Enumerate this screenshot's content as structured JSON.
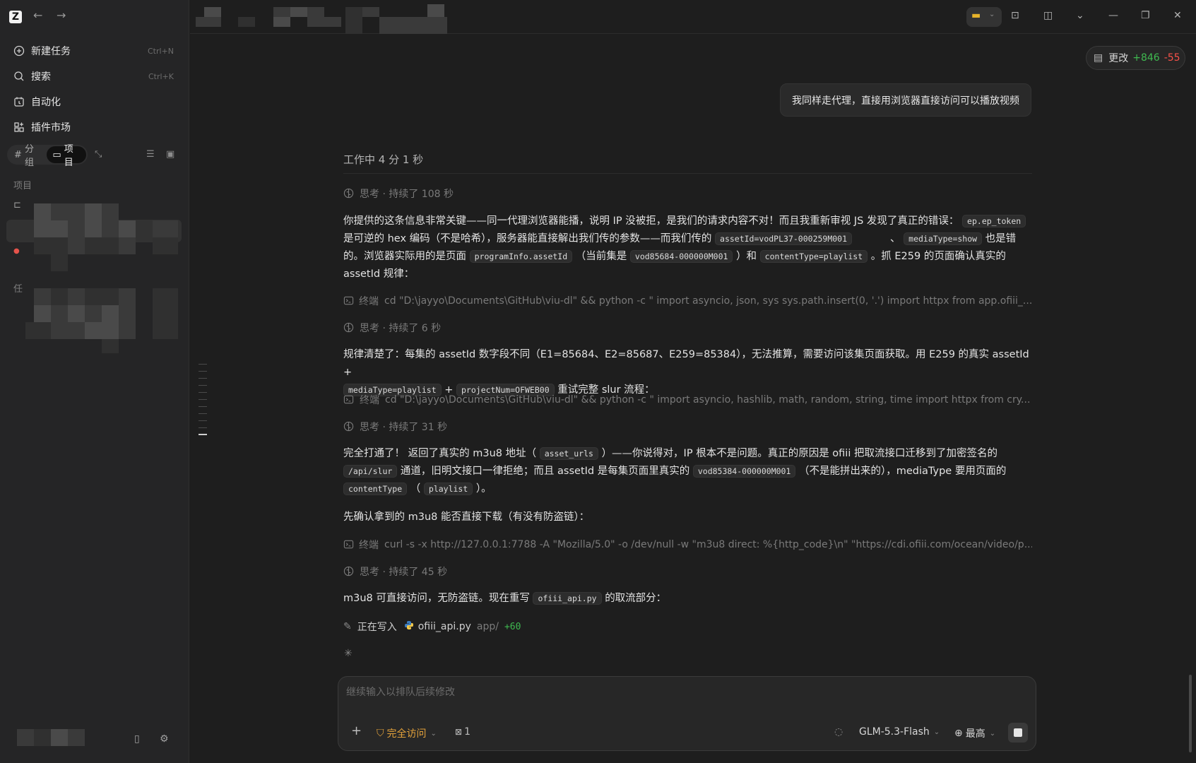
{
  "app": {
    "logo": "Z"
  },
  "sidebar": {
    "menu": [
      {
        "label": "新建任务",
        "shortcut": "Ctrl+N",
        "icon": "new-task-icon"
      },
      {
        "label": "搜索",
        "shortcut": "Ctrl+K",
        "icon": "search-icon"
      },
      {
        "label": "自动化",
        "shortcut": "",
        "icon": "automation-icon"
      },
      {
        "label": "插件市场",
        "shortcut": "",
        "icon": "plugin-icon"
      }
    ],
    "segment": {
      "group": "分组",
      "project": "项目"
    },
    "section_projects": "项目",
    "section_tasks": "任"
  },
  "header": {
    "changes_label": "更改",
    "additions": "+846",
    "deletions": "-55"
  },
  "conversation": {
    "user_message": "我同样走代理，直接用浏览器直接访问可以播放视频",
    "working_status": "工作中 4 分 1 秒",
    "think1": "思考 · 持续了 108 秒",
    "p1": [
      "你提供的这条信息非常关键——同一代理浏览器能播，说明 IP 没被拒，是我们的请求内容不对！而且我重新审视 JS 发现了真正的错误：",
      "ep.ep_token",
      "是可逆的 hex 编码（不是哈希），服务器能直接解出我们传的参数——而我们传的",
      "assetId=vodPL37-000259M001",
      "、",
      "mediaType=show",
      "也是错的。浏览器实际用的是页面",
      "programInfo.assetId",
      "（当前集是",
      "vod85684-000000M001",
      "）和",
      "contentType=playlist",
      "。抓 E259 的页面确认真实的 assetId 规律："
    ],
    "cmd1_label": "终端",
    "cmd1": "cd \"D:\\jayyo\\Documents\\GitHub\\viu-dl\" && python -c \" import asyncio, json, sys sys.path.insert(0, '.') import httpx from app.ofiii_...",
    "think2": "思考 · 持续了 6 秒",
    "p2": [
      "规律清楚了：每集的 assetId 数字段不同（E1=85684、E2=85687、E259=85384），无法推算，需要访问该集页面获取。用 E259 的真实 assetId +",
      "mediaType=playlist",
      "+",
      "projectNum=OFWEB00",
      "重试完整 slur 流程："
    ],
    "cmd2_label": "终端",
    "cmd2": "cd \"D:\\jayyo\\Documents\\GitHub\\viu-dl\" && python -c \" import asyncio, hashlib, math, random, string, time import httpx from cry...",
    "think3": "思考 · 持续了 31 秒",
    "p3": [
      "完全打通了！ 返回了真实的 m3u8 地址（",
      "asset_urls",
      "）——你说得对，IP 根本不是问题。真正的原因是 ofiii 把取流接口迁移到了加密签名的",
      "/api/slur",
      "通道，旧明文接口一律拒绝；而且 assetId 是每集页面里真实的",
      "vod85384-000000M001",
      "（不是能拼出来的），mediaType 要用页面的",
      "contentType",
      "（",
      "playlist",
      "）。"
    ],
    "p4": "先确认拿到的 m3u8 能否直接下载（有没有防盗链）：",
    "cmd3_label": "终端",
    "cmd3": "curl -s -x http://127.0.0.1:7788 -A \"Mozilla/5.0\" -o /dev/null -w \"m3u8 direct: %{http_code}\\n\" \"https://cdi.ofiii.com/ocean/video/p...",
    "think4": "思考 · 持续了 45 秒",
    "p5": [
      "m3u8 可直接访问，无防盗链。现在重写",
      "ofiii_api.py",
      "的取流部分："
    ],
    "writing_label": "正在写入",
    "writing_file": "ofiii_api.py",
    "writing_dir": "app/",
    "writing_add": "+60"
  },
  "composer": {
    "placeholder": "继续输入以排队后续修改",
    "access_label": "完全访问",
    "context_count": "1",
    "model": "GLM-5.3-Flash",
    "effort": "最高"
  },
  "colors": {
    "added": "#3fb950",
    "removed": "#f85149",
    "access": "#e3a23b"
  }
}
